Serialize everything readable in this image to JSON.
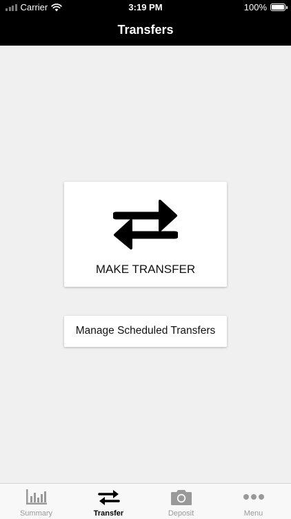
{
  "status_bar": {
    "carrier": "Carrier",
    "time": "3:19 PM",
    "battery": "100%"
  },
  "header": {
    "title": "Transfers"
  },
  "main": {
    "make_transfer_label": "MAKE TRANSFER",
    "make_transfer_icon": "swap-arrows-icon",
    "manage_label": "Manage Scheduled Transfers"
  },
  "tabbar": {
    "active": "Transfer",
    "active_color": "#000000",
    "inactive_color": "#9a9a9a",
    "tabs": [
      {
        "label": "Summary",
        "icon": "bar-chart-icon"
      },
      {
        "label": "Transfer",
        "icon": "swap-arrows-icon"
      },
      {
        "label": "Deposit",
        "icon": "camera-icon"
      },
      {
        "label": "Menu",
        "icon": "more-dots-icon"
      }
    ]
  }
}
